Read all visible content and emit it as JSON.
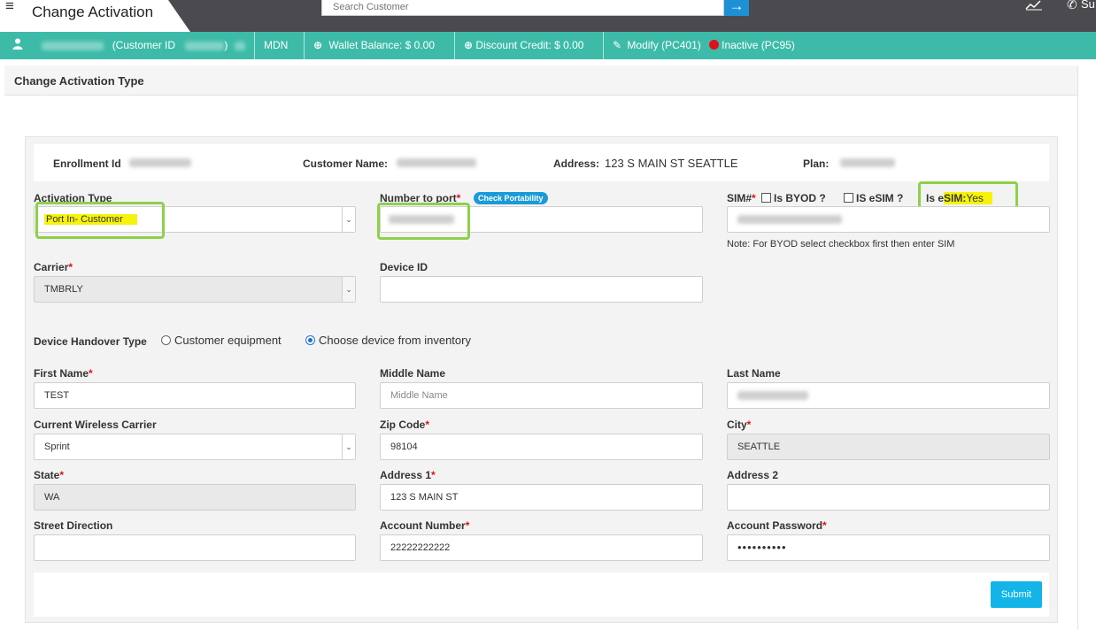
{
  "header": {
    "title": "Change Activation",
    "search_placeholder": "Search Customer",
    "right_cut_text": "Su"
  },
  "infobar": {
    "customer_id_label": "(Customer ID",
    "customer_id_close": ")",
    "mdn": "MDN",
    "wallet": "Wallet Balance: $ 0.00",
    "discount": "Discount Credit: $ 0.00",
    "modify": "Modify (PC401)",
    "inactive": "Inactive (PC95)"
  },
  "section": {
    "title": "Change Activation Type"
  },
  "enrollment": {
    "enrollment_id_label": "Enrollment Id",
    "customer_name_label": "Customer Name:",
    "address_label": "Address:",
    "address_value": "123 S MAIN ST SEATTLE",
    "plan_label": "Plan:"
  },
  "form": {
    "activation_type_label": "Activation Type",
    "activation_type_value": "Port In- Customer",
    "number_to_port_label": "Number to port",
    "check_portability": "Check Portability",
    "sim_label": "SIM#",
    "is_byod": "Is BYOD ?",
    "is_esim_chk": "IS eSIM ?",
    "is_esim_prefix": "Is e",
    "is_esim_sim": "SIM:",
    "is_esim_value": "Yes",
    "byod_note": "Note: For BYOD select checkbox first then enter SIM",
    "carrier_label": "Carrier",
    "carrier_value": "TMBRLY",
    "device_id_label": "Device ID",
    "handover_label": "Device Handover Type",
    "handover_opt1": "Customer equipment",
    "handover_opt2": "Choose device from inventory",
    "first_name_label": "First Name",
    "first_name_value": "TEST",
    "middle_name_label": "Middle Name",
    "middle_name_placeholder": "Middle Name",
    "last_name_label": "Last Name",
    "wireless_carrier_label": "Current Wireless Carrier",
    "wireless_carrier_value": "Sprint",
    "zip_label": "Zip Code",
    "zip_value": "98104",
    "city_label": "City",
    "city_value": "SEATTLE",
    "state_label": "State",
    "state_value": "WA",
    "address1_label": "Address 1",
    "address1_value": "123 S MAIN ST",
    "address2_label": "Address 2",
    "street_dir_label": "Street Direction",
    "account_number_label": "Account Number",
    "account_number_value": "22222222222",
    "account_password_label": "Account Password",
    "account_password_value": "••••••••••",
    "submit": "Submit",
    "required_mark": "*"
  },
  "colors": {
    "infobar": "#3dbba8",
    "topbar": "#4a4a4f",
    "highlight": "#f6f30a",
    "callout_border": "#8dd14a",
    "submit": "#13b5e8"
  }
}
